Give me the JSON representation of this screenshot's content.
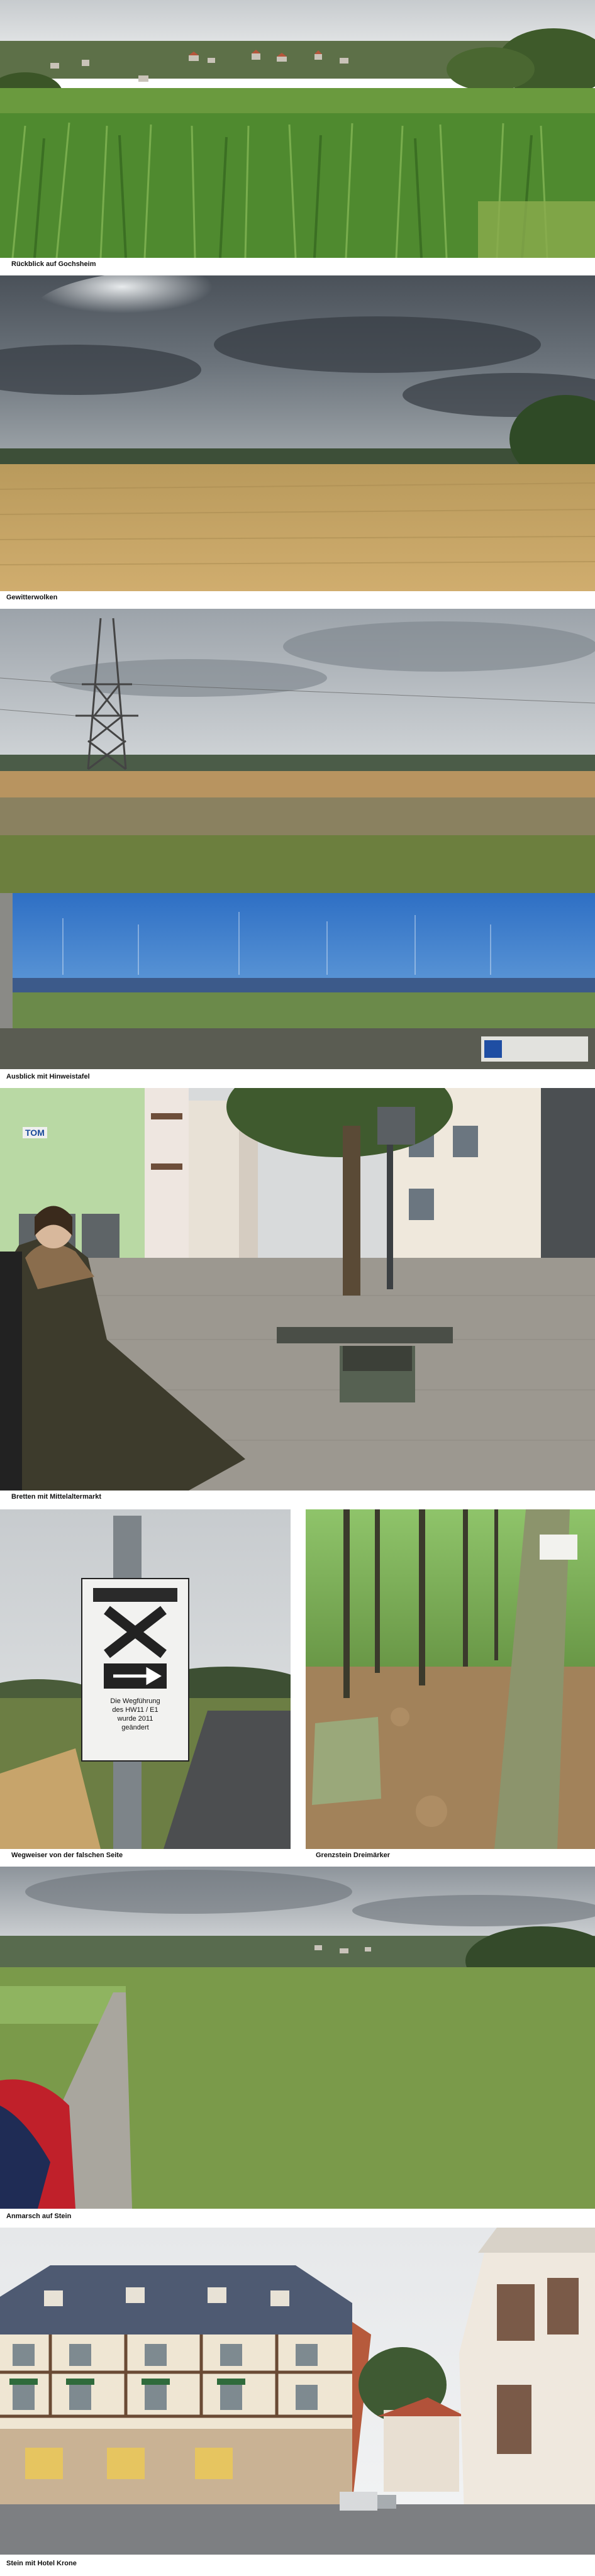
{
  "captions": {
    "gochsheim": "Rückblick auf Gochsheim",
    "gewitter": "Gewitterwolken",
    "ausblick": "Ausblick mit Hinweistafel",
    "bretten": "Bretten mit Mittelaltermarkt",
    "wegweiser": "Wegweiser von der falschen Seite",
    "grenzstein": "Grenzstein Dreimärker",
    "anmarsch": "Anmarsch auf Stein",
    "stein": "Stein mit Hotel Krone"
  },
  "signs": {
    "wegweiser_text": [
      "Die Wegführung",
      "des HW11 / E1",
      "wurde 2011",
      "geändert"
    ],
    "tom_sign": "TOM"
  },
  "colors": {
    "sky_grey": "#b9bec3",
    "storm_cloud": "#4a5159",
    "wheat": "#c9a463",
    "corn_green": "#4f8a2f",
    "panorama_blue": "#2e6fc4"
  }
}
